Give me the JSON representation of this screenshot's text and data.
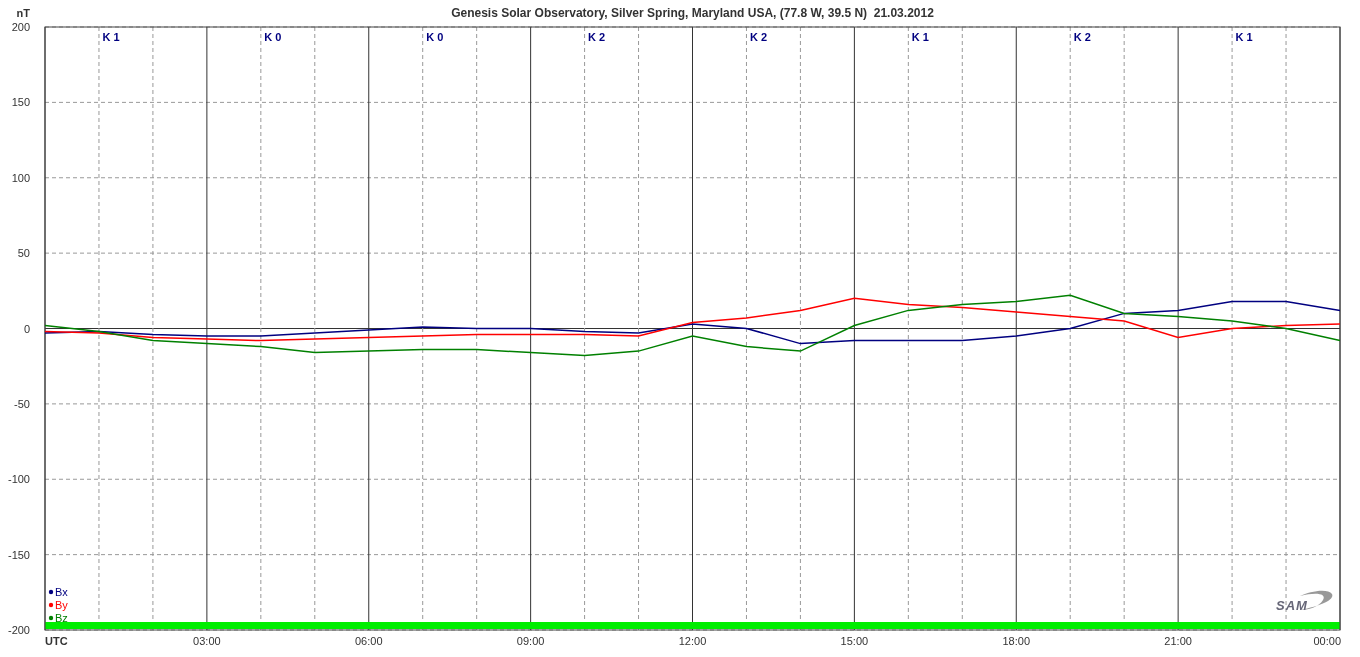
{
  "chart_data": {
    "type": "line",
    "title": "Genesis Solar Observatory, Silver Spring, Maryland USA, (77.8 W, 39.5 N)  21.03.2012",
    "ylabel": "nT",
    "xlim": [
      0,
      24
    ],
    "ylim": [
      -200,
      200
    ],
    "x": [
      0,
      1,
      2,
      3,
      4,
      5,
      6,
      7,
      8,
      9,
      10,
      11,
      12,
      13,
      14,
      15,
      16,
      17,
      18,
      19,
      20,
      21,
      22,
      23,
      24
    ],
    "xticks": [
      {
        "value": 0,
        "label": "UTC"
      },
      {
        "value": 3,
        "label": "03:00"
      },
      {
        "value": 6,
        "label": "06:00"
      },
      {
        "value": 9,
        "label": "09:00"
      },
      {
        "value": 12,
        "label": "12:00"
      },
      {
        "value": 15,
        "label": "15:00"
      },
      {
        "value": 18,
        "label": "18:00"
      },
      {
        "value": 21,
        "label": "21:00"
      },
      {
        "value": 24,
        "label": "00:00"
      }
    ],
    "yticks": [
      -200,
      -150,
      -100,
      -50,
      0,
      50,
      100,
      150,
      200
    ],
    "series": [
      {
        "name": "Bx",
        "color": "#000080",
        "values": [
          -3,
          -2,
          -4,
          -5,
          -5,
          -3,
          -1,
          1,
          0,
          0,
          -2,
          -3,
          3,
          0,
          -10,
          -8,
          -8,
          -8,
          -5,
          0,
          10,
          12,
          18,
          18,
          12
        ]
      },
      {
        "name": "By",
        "color": "#ff0000",
        "values": [
          -2,
          -3,
          -6,
          -7,
          -8,
          -7,
          -6,
          -5,
          -4,
          -4,
          -4,
          -5,
          4,
          7,
          12,
          20,
          16,
          14,
          11,
          8,
          5,
          -6,
          0,
          2,
          3
        ]
      },
      {
        "name": "Bz",
        "color": "#008000",
        "values": [
          2,
          -2,
          -8,
          -10,
          -12,
          -16,
          -15,
          -14,
          -14,
          -16,
          -18,
          -15,
          -5,
          -12,
          -15,
          2,
          12,
          16,
          18,
          22,
          10,
          8,
          5,
          0,
          -8
        ]
      }
    ],
    "grid": true
  },
  "k_indices": [
    "K 1",
    "K 0",
    "K 0",
    "K 2",
    "K 2",
    "K 1",
    "K 2",
    "K 1"
  ],
  "logo": "SAM"
}
